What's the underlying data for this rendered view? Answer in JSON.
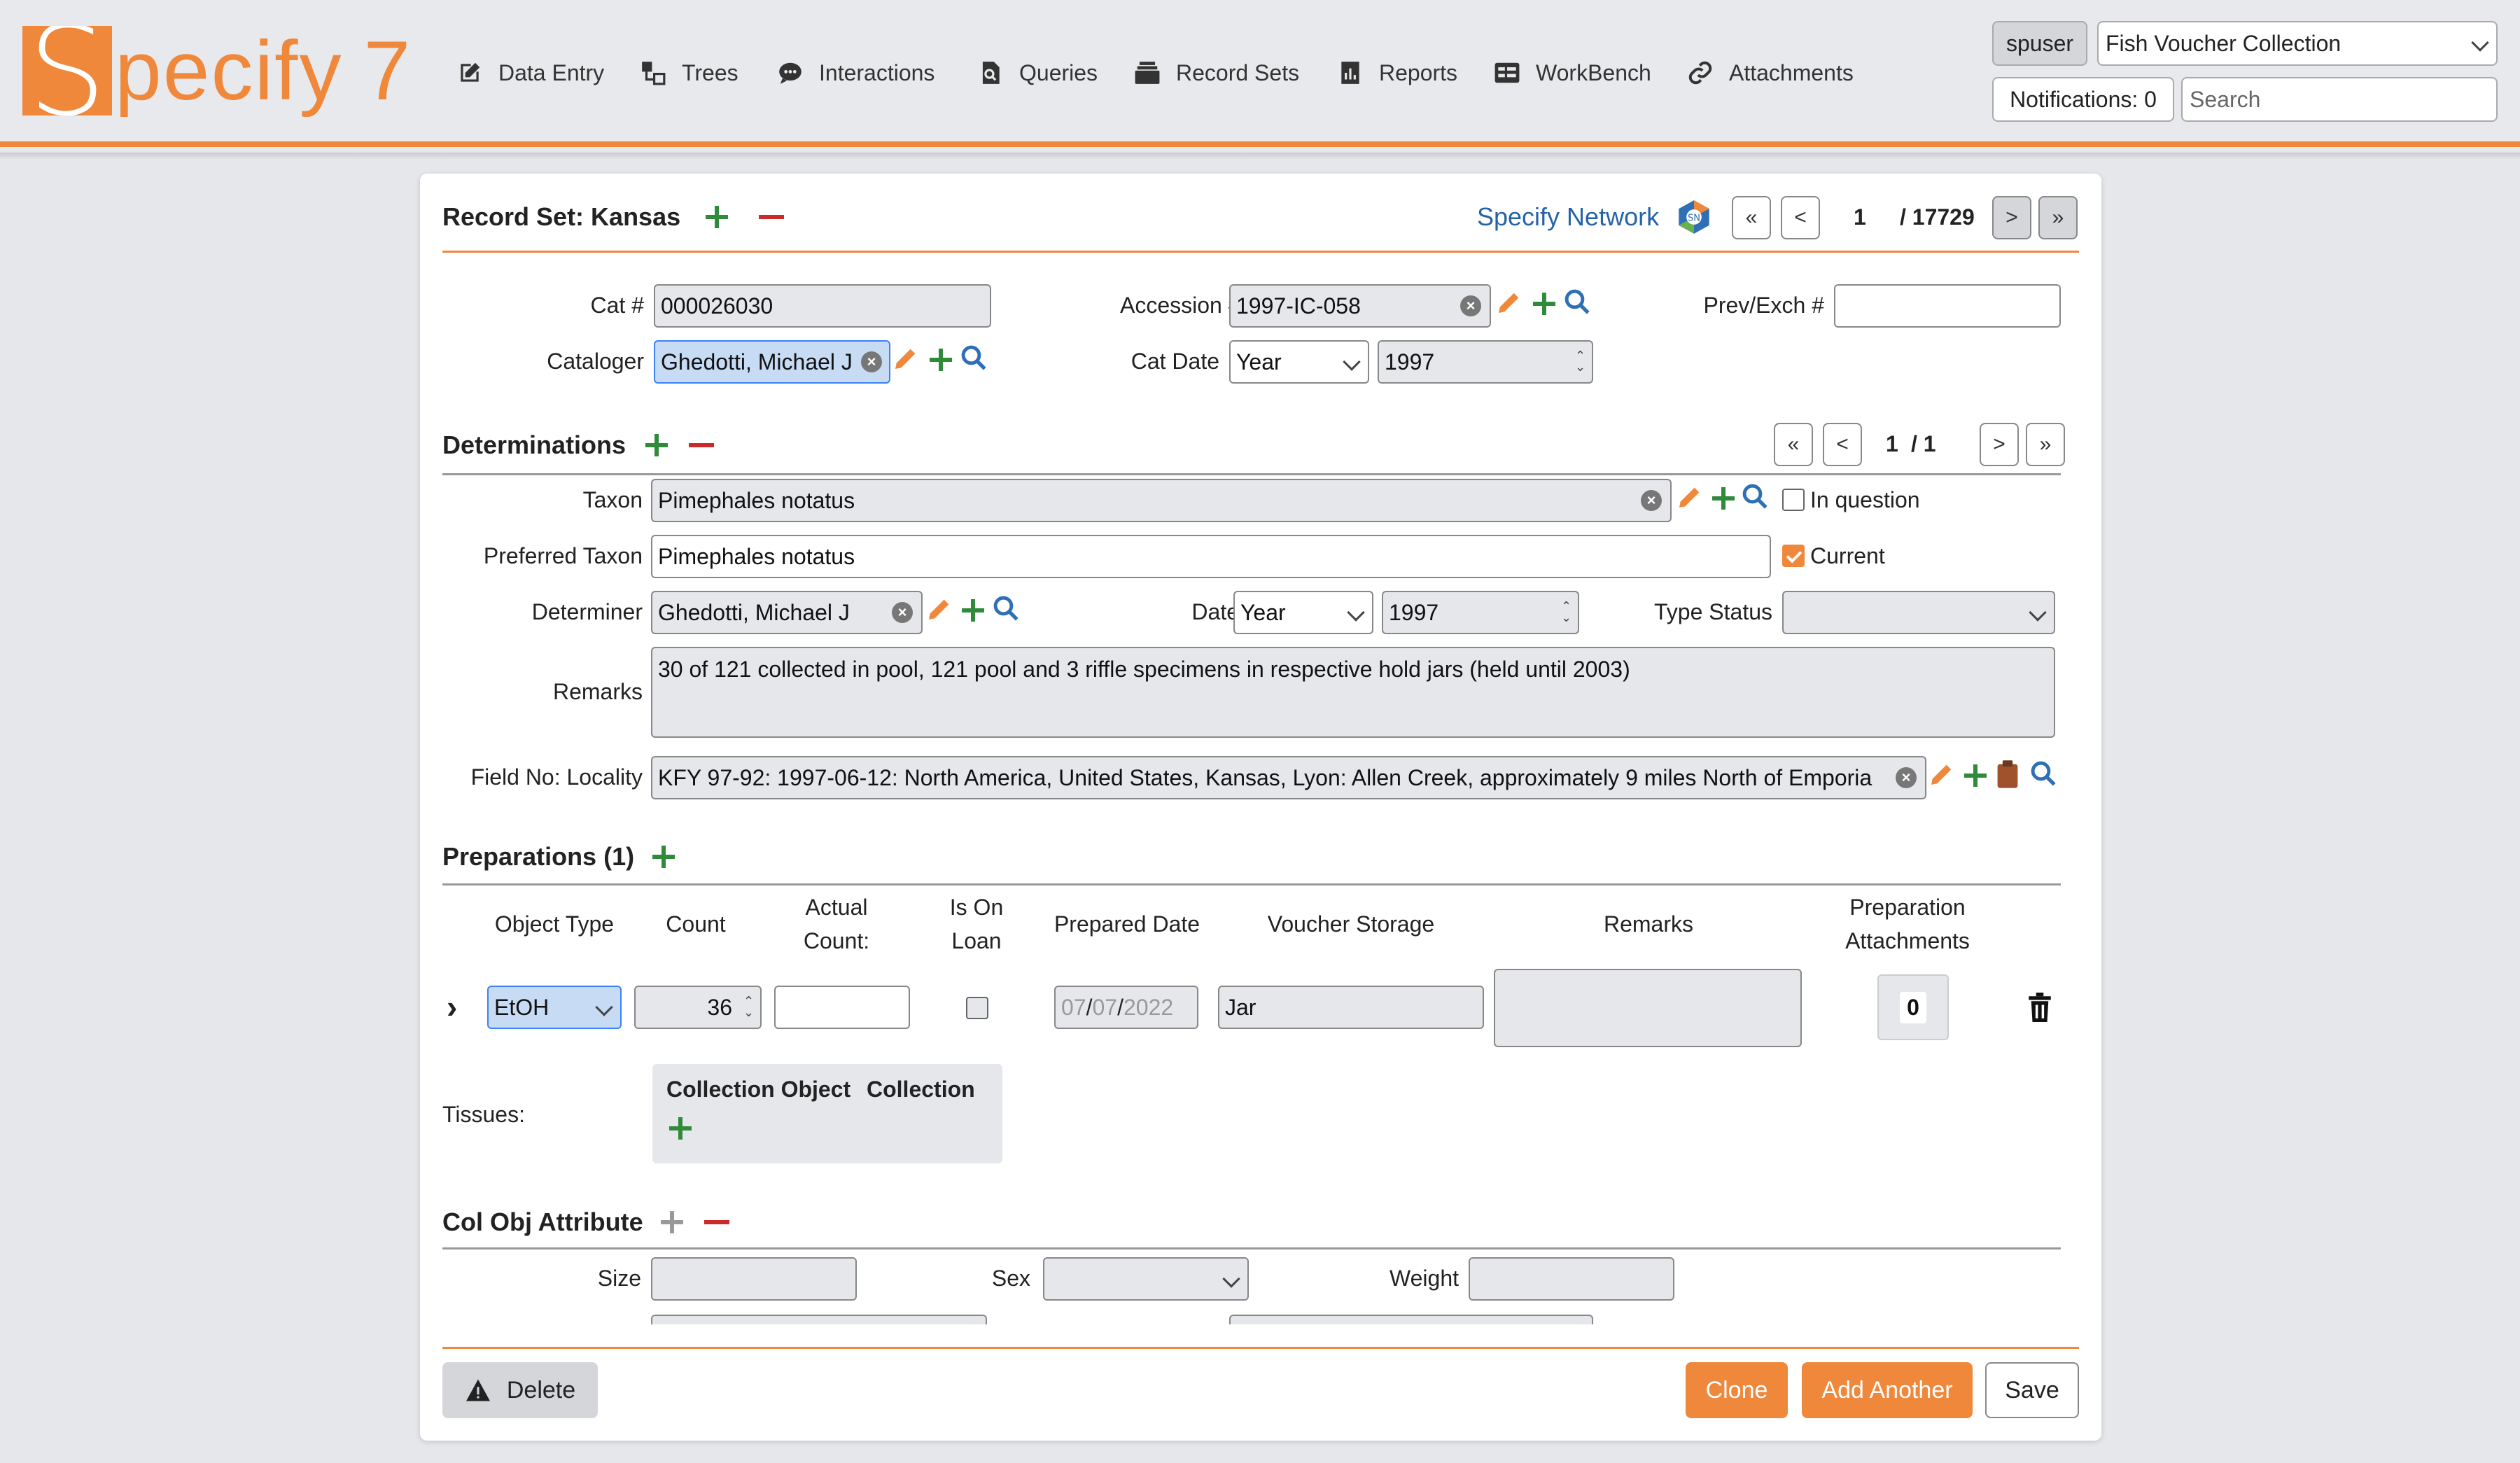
{
  "header": {
    "logo_text": "Specify 7",
    "nav": [
      {
        "label": "Data Entry",
        "icon": "pencil-square-icon"
      },
      {
        "label": "Trees",
        "icon": "tree-icon"
      },
      {
        "label": "Interactions",
        "icon": "chat-icon"
      },
      {
        "label": "Queries",
        "icon": "query-icon"
      },
      {
        "label": "Record Sets",
        "icon": "stack-icon"
      },
      {
        "label": "Reports",
        "icon": "report-icon"
      },
      {
        "label": "WorkBench",
        "icon": "table-icon"
      },
      {
        "label": "Attachments",
        "icon": "link-icon"
      }
    ],
    "user": "spuser",
    "collection": "Fish Voucher Collection",
    "notifications": "Notifications: 0",
    "search_placeholder": "Search"
  },
  "record_set": {
    "title": "Record Set: Kansas",
    "network_label": "Specify Network",
    "pager_current": "1",
    "pager_total": "/ 17729"
  },
  "collection_object": {
    "cat_label": "Cat #",
    "cat_value": "000026030",
    "accession_label": "Accession #",
    "accession_value": "1997-IC-058",
    "prev_exch_label": "Prev/Exch #",
    "prev_exch_value": "",
    "cataloger_label": "Cataloger",
    "cataloger_value": "Ghedotti, Michael J",
    "cat_date_label": "Cat Date",
    "cat_date_precision": "Year",
    "cat_date_value": "1997"
  },
  "determinations": {
    "title": "Determinations",
    "pager_current": "1",
    "pager_total": "/ 1",
    "taxon_label": "Taxon",
    "taxon_value": "Pimephales notatus",
    "in_question_label": "In question",
    "preferred_taxon_label": "Preferred Taxon",
    "preferred_taxon_value": "Pimephales notatus",
    "current_label": "Current",
    "determiner_label": "Determiner",
    "determiner_value": "Ghedotti, Michael J",
    "date_label": "Date",
    "date_precision": "Year",
    "date_value": "1997",
    "type_status_label": "Type Status",
    "type_status_value": "",
    "remarks_label": "Remarks",
    "remarks_value": "30 of 121 collected in pool, 121 pool and 3 riffle specimens in respective hold jars (held until 2003)",
    "field_no_label": "Field No: Locality",
    "field_no_value": "KFY 97-92: 1997-06-12: North America, United States, Kansas, Lyon: Allen Creek, approximately 9 miles North of Emporia"
  },
  "preparations": {
    "title": "Preparations (1)",
    "columns": {
      "object_type": "Object Type",
      "count": "Count",
      "actual_count_1": "Actual",
      "actual_count_2": "Count:",
      "is_on_loan_1": "Is On",
      "is_on_loan_2": "Loan",
      "prepared_date": "Prepared Date",
      "voucher_storage": "Voucher Storage",
      "remarks": "Remarks",
      "prep_attach_1": "Preparation",
      "prep_attach_2": "Attachments"
    },
    "row": {
      "expand": "›",
      "object_type": "EtOH",
      "count": "36",
      "actual_count": "",
      "date_mm": "07",
      "date_dd": "07",
      "date_yyyy": "2022",
      "voucher_storage": "Jar",
      "remarks": "",
      "attachments": "0"
    },
    "tissues_label": "Tissues:",
    "tissues_col1": "Collection Object",
    "tissues_col2": "Collection"
  },
  "col_obj_attribute": {
    "title": "Col Obj Attribute",
    "size_label": "Size",
    "sex_label": "Sex",
    "weight_label": "Weight"
  },
  "footer": {
    "delete": "Delete",
    "clone": "Clone",
    "add_another": "Add Another",
    "save": "Save"
  }
}
